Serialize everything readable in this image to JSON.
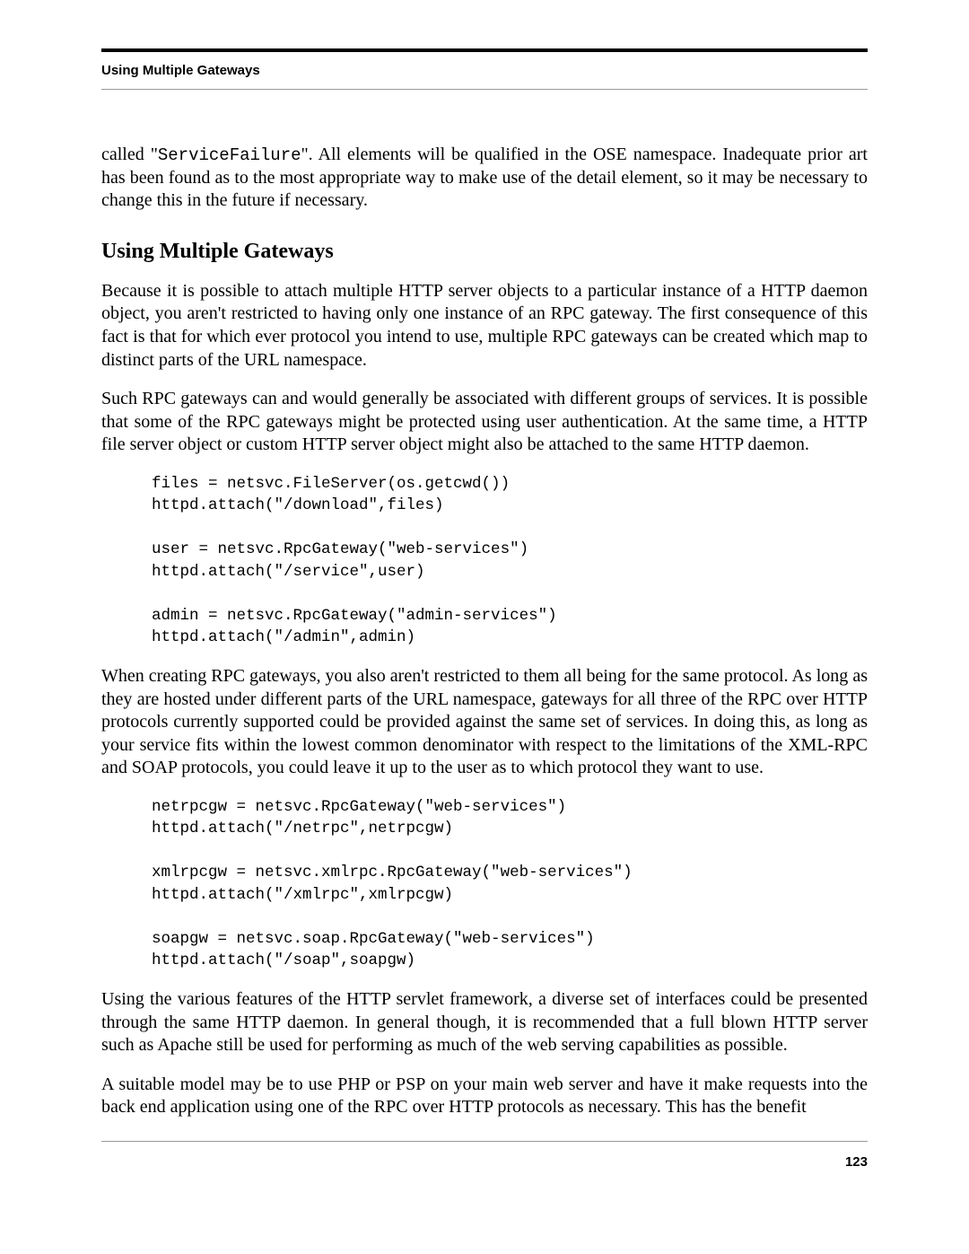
{
  "header": {
    "running_head": "Using Multiple Gateways"
  },
  "intro": {
    "pre": "called \"",
    "code": "ServiceFailure",
    "post": "\". All elements will be qualified in the OSE namespace. Inadequate prior art has been found as to the most appropriate way to make use of the detail element, so it may be necessary to change this in the future if necessary."
  },
  "section": {
    "title": "Using Multiple Gateways",
    "p1": "Because it is possible to attach multiple HTTP server objects to a particular instance of a HTTP daemon object, you aren't restricted to having only one instance of an RPC gateway. The first consequence of this fact is that for which ever protocol you intend to use, multiple RPC gateways can be created which map to distinct parts of the URL namespace.",
    "p2": "Such RPC gateways can and would generally be associated with different groups of services. It is possible that some of the RPC gateways might be protected using user authentication. At the same time, a HTTP file server object or custom HTTP server object might also be attached to the same HTTP daemon.",
    "code1": "files = netsvc.FileServer(os.getcwd())\nhttpd.attach(\"/download\",files)\n\nuser = netsvc.RpcGateway(\"web-services\")\nhttpd.attach(\"/service\",user)\n\nadmin = netsvc.RpcGateway(\"admin-services\")\nhttpd.attach(\"/admin\",admin)",
    "p3": "When creating RPC gateways, you also aren't restricted to them all being for the same protocol. As long as they are hosted under different parts of the URL namespace, gateways for all three of the RPC over HTTP protocols currently supported could be provided against the same set of services. In doing this, as long as your service fits within the lowest common denominator with respect to the limitations of the XML-RPC and SOAP protocols, you could leave it up to the user as to which protocol they want to use.",
    "code2": "netrpcgw = netsvc.RpcGateway(\"web-services\")\nhttpd.attach(\"/netrpc\",netrpcgw)\n\nxmlrpcgw = netsvc.xmlrpc.RpcGateway(\"web-services\")\nhttpd.attach(\"/xmlrpc\",xmlrpcgw)\n\nsoapgw = netsvc.soap.RpcGateway(\"web-services\")\nhttpd.attach(\"/soap\",soapgw)",
    "p4": "Using the various features of the HTTP servlet framework, a diverse set of interfaces could be presented through the same HTTP daemon. In general though, it is recommended that a full blown HTTP server such as Apache still be used for performing as much of the web serving capabilities as possible.",
    "p5": "A suitable model may be to use PHP or PSP on your main web server and have it make requests into the back end application using one of the RPC over HTTP protocols as necessary. This has the benefit"
  },
  "footer": {
    "page": "123"
  }
}
